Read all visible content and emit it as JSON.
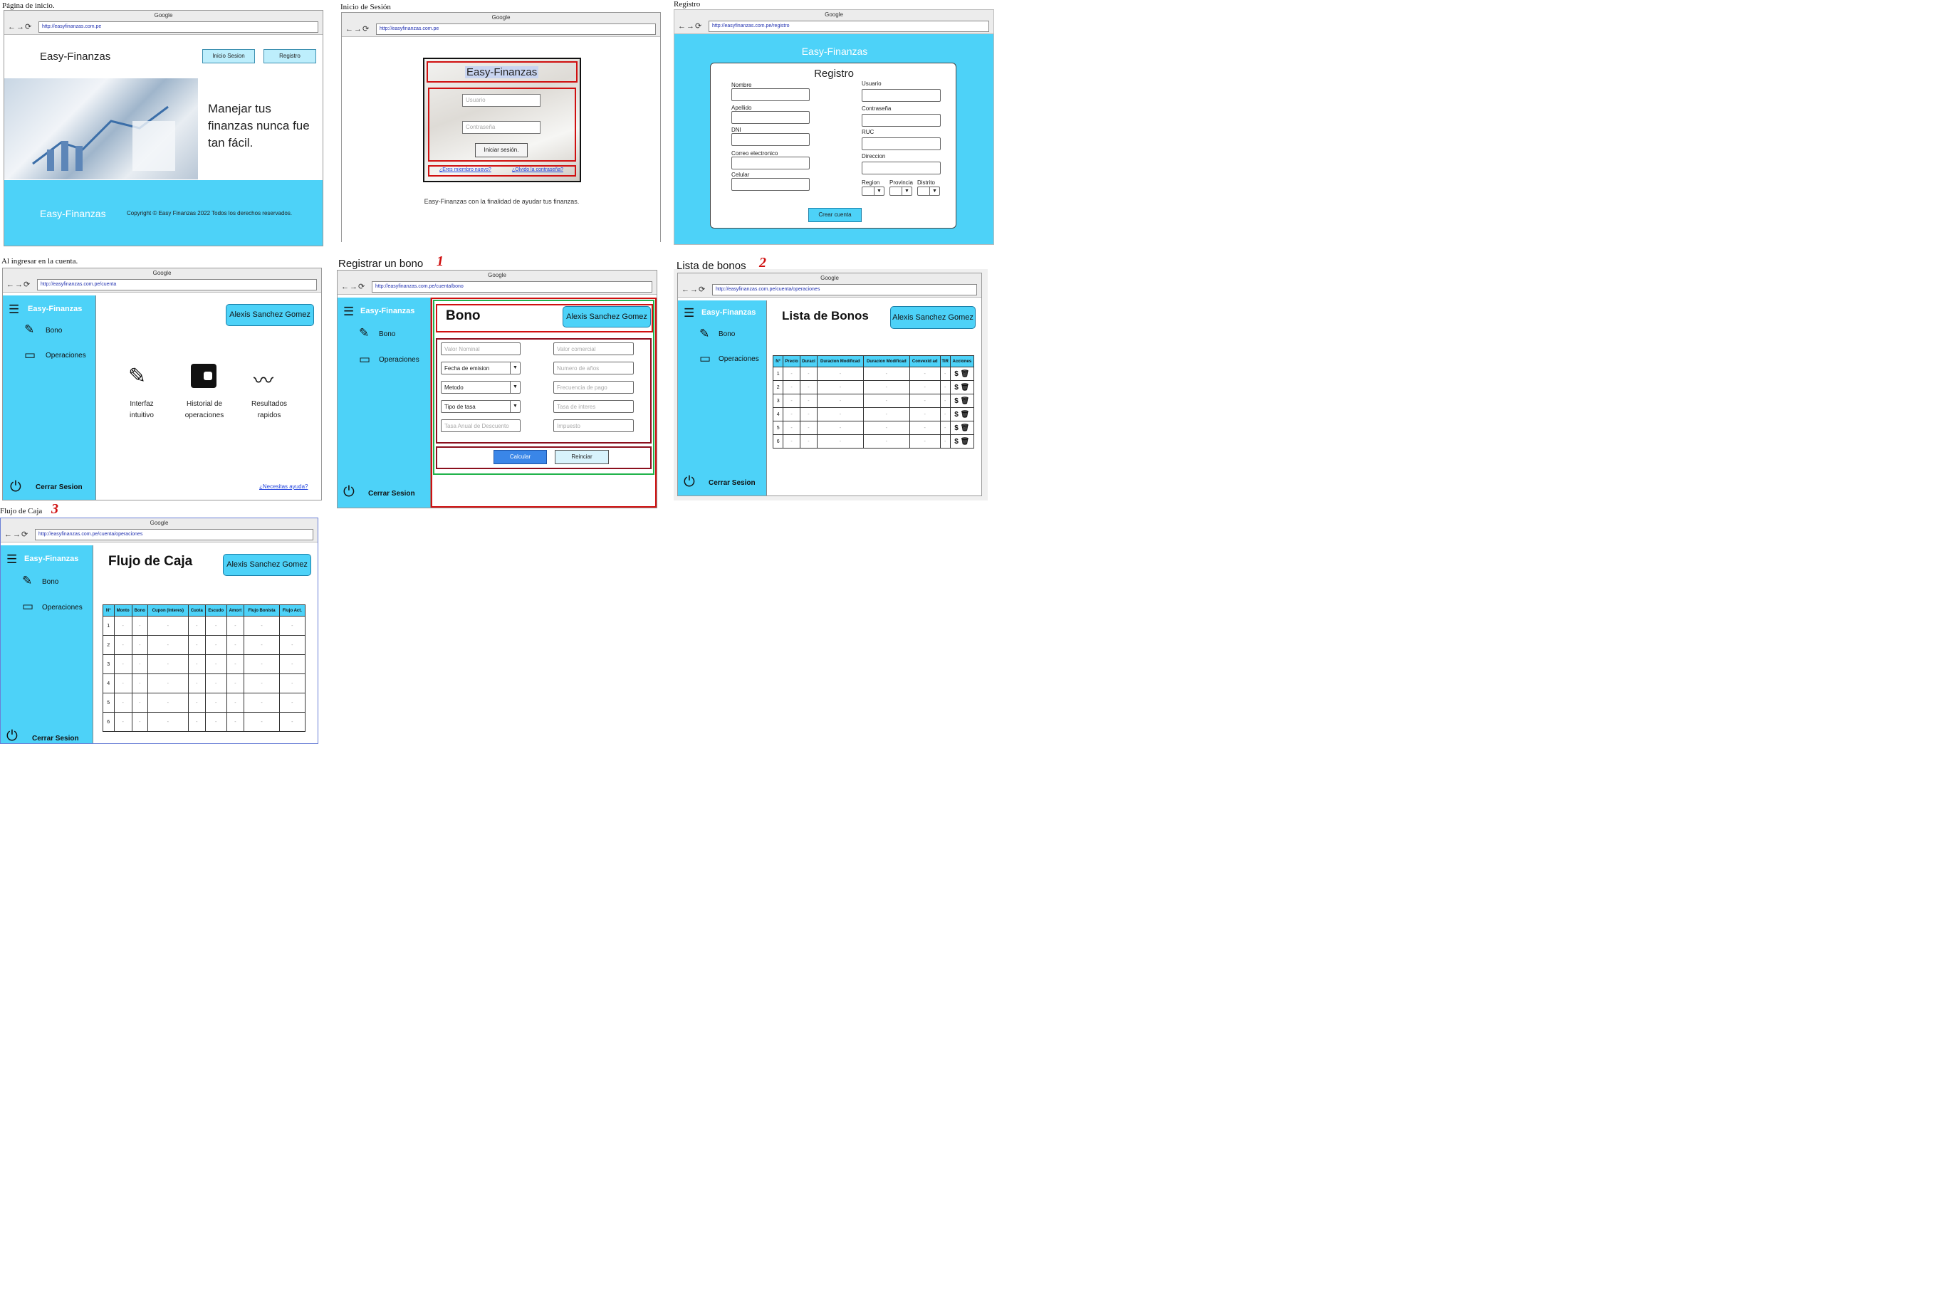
{
  "captions": {
    "inicio": "Página de inicio.",
    "login": "Inicio de Sesión",
    "registro": "Registro",
    "cuenta": "Al ingresar en la cuenta.",
    "bono": "Registrar un bono",
    "bono_num": "1",
    "lista": "Lista de bonos",
    "lista_num": "2",
    "flujo": "Flujo de Caja",
    "flujo_num": "3"
  },
  "browser": {
    "title": "Google",
    "nav_icons": "←→⟳"
  },
  "home": {
    "url": "http://easyfinanzas.com.pe",
    "logo": "Easy-Finanzas",
    "login_btn": "Inicio Sesion",
    "register_btn": "Registro",
    "hero_text": "Manejar tus finanzas nunca fue tan fácil.",
    "footer_brand": "Easy-Finanzas",
    "copyright": "Copyright  © Easy Finanzas 2022 Todos los derechos reservados."
  },
  "login": {
    "url": "http://easyfinanzas.com.pe",
    "title": "Easy-Finanzas",
    "user_placeholder": "Usuario",
    "pass_placeholder": "Contraseña",
    "submit": "Iniciar sesión.",
    "new_member": "¿Eres miembro nuevo?",
    "forgot": "¿Olvido la contraseña?",
    "tagline": "Easy-Finanzas con la finalidad de ayudar tus finanzas."
  },
  "register": {
    "url": "http://easyfinanzas.com.pe/registro",
    "brand": "Easy-Finanzas",
    "title": "Registro",
    "left_fields": [
      "Nombre",
      "Apellido",
      "DNI",
      "Correo electronico",
      "Celular"
    ],
    "right_fields": [
      "Usuario",
      "Contraseña",
      "RUC",
      "Direccion"
    ],
    "region": "Region",
    "provincia": "Provincia",
    "distrito": "Distrito",
    "submit": "Crear cuenta"
  },
  "app": {
    "brand": "Easy-Finanzas",
    "menu_bono": "Bono",
    "menu_operaciones": "Operaciones",
    "logout": "Cerrar Sesion",
    "user": "Alexis Sanchez Gomez"
  },
  "cuenta": {
    "url": "http://easyfinanzas.com.pe/cuenta",
    "features": [
      "Interfaz intuitivo",
      "Historial de operaciones",
      "Resultados rapidos"
    ],
    "help": "¿Necesitas ayuda?"
  },
  "bono": {
    "url": "http://easyfinanzas.com.pe/cuenta/bono",
    "title": "Bono",
    "left": [
      "Valor Nominal",
      "Fecha de emision",
      "Metodo",
      "Tipo de tasa",
      "Tasa Anual de Descuento"
    ],
    "right": [
      "Valor comercial",
      "Numero de años",
      "Frecuencia de pago",
      "Tasa de interes",
      "Impuesto"
    ],
    "calcular": "Calcular",
    "reiniciar": "Reinciar"
  },
  "lista": {
    "url": "http://easyfinanzas.com.pe/cuenta/operaciones",
    "title": "Lista de Bonos",
    "headers": [
      "N°",
      "Precio",
      "Duraci",
      "Duracion Modificad",
      "Duracion Modificad",
      "Convexid ad",
      "TIR",
      "Acciones"
    ],
    "rows": [
      "1",
      "2",
      "3",
      "4",
      "5",
      "6"
    ],
    "dash": "-",
    "icons": "$ 🗑"
  },
  "flujo": {
    "url": "http://easyfinanzas.com.pe/cuenta/operaciones",
    "title": "Flujo de Caja",
    "headers": [
      "N°",
      "Monto",
      "Bono",
      "Cupon (Interes)",
      "Cuota",
      "Escudo",
      "Amort",
      "Flujo Bonista",
      "Flujo Act."
    ],
    "rows": [
      "1",
      "2",
      "3",
      "4",
      "5",
      "6"
    ],
    "dash": "-"
  }
}
